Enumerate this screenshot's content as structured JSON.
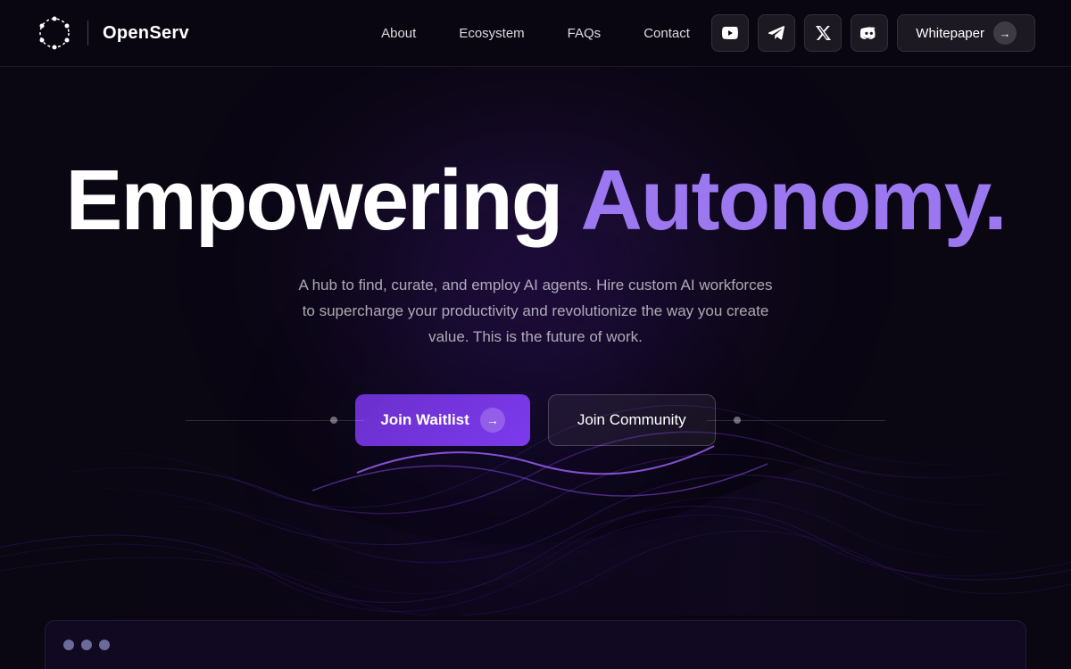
{
  "brand": {
    "name": "OpenServ"
  },
  "nav": {
    "links": [
      {
        "id": "about",
        "label": "About"
      },
      {
        "id": "ecosystem",
        "label": "Ecosystem"
      },
      {
        "id": "faqs",
        "label": "FAQs"
      },
      {
        "id": "contact",
        "label": "Contact"
      }
    ],
    "social": [
      {
        "id": "youtube",
        "icon": "▶",
        "label": "YouTube"
      },
      {
        "id": "telegram",
        "icon": "✈",
        "label": "Telegram"
      },
      {
        "id": "twitter",
        "icon": "𝕏",
        "label": "Twitter"
      },
      {
        "id": "discord",
        "icon": "⚙",
        "label": "Discord"
      }
    ],
    "whitepaper_label": "Whitepaper"
  },
  "hero": {
    "title_part1": "Empowering ",
    "title_part2": "Autonomy.",
    "subtitle": "A hub to find, curate, and employ AI agents. Hire custom AI workforces to supercharge your productivity and revolutionize the way you create value. This is the future of work.",
    "btn_waitlist": "Join Waitlist",
    "btn_community": "Join Community"
  },
  "browser_dots": [
    {
      "color": "#6b6b9a"
    },
    {
      "color": "#6b6b9a"
    },
    {
      "color": "#6b6b9a"
    }
  ]
}
